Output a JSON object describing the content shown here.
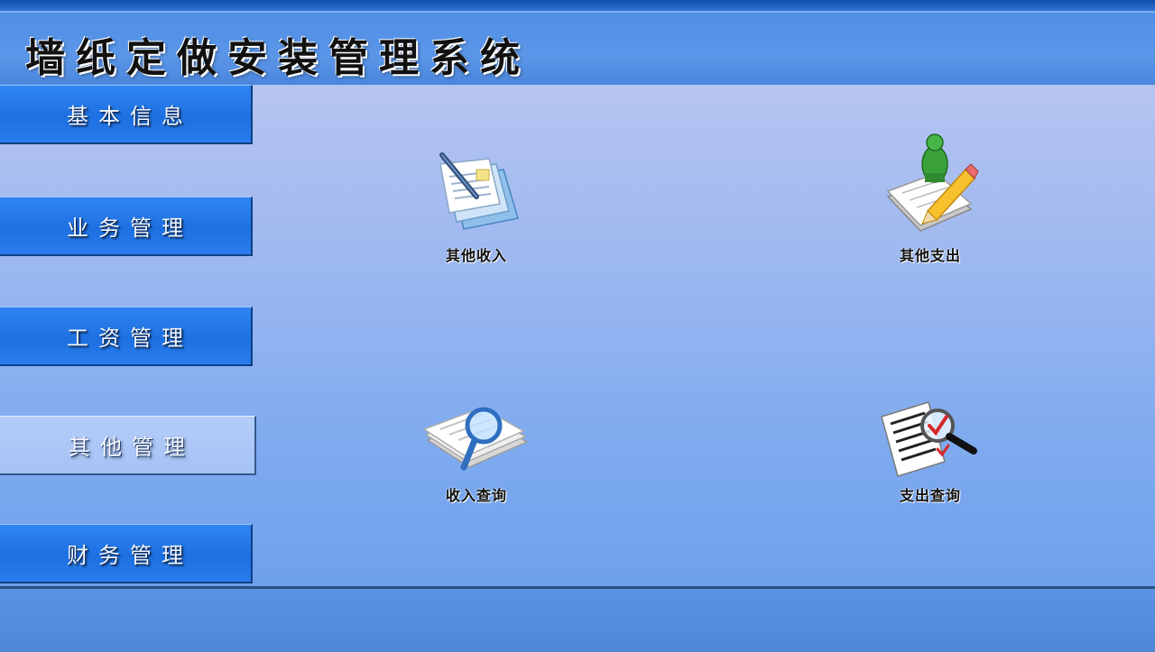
{
  "app": {
    "title": "墙纸定做安装管理系统"
  },
  "sidebar": {
    "items": [
      {
        "label": "基本信息",
        "active": false
      },
      {
        "label": "业务管理",
        "active": false
      },
      {
        "label": "工资管理",
        "active": false
      },
      {
        "label": "其他管理",
        "active": true
      },
      {
        "label": "财务管理",
        "active": false
      }
    ]
  },
  "main": {
    "tiles": [
      {
        "label": "其他收入",
        "icon": "document-pen-icon"
      },
      {
        "label": "其他支出",
        "icon": "notebook-pencil-icon"
      },
      {
        "label": "收入查询",
        "icon": "papers-magnifier-icon"
      },
      {
        "label": "支出查询",
        "icon": "checklist-magnifier-icon"
      }
    ]
  }
}
